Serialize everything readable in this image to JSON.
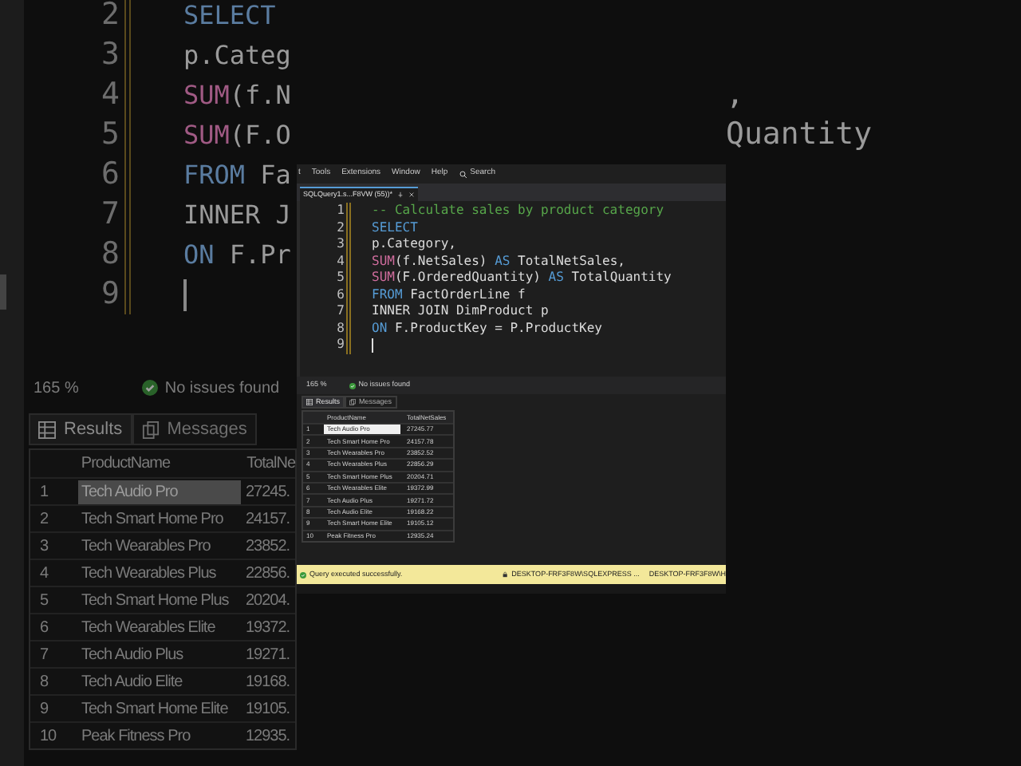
{
  "background_editor": {
    "lines": [
      {
        "number": "2",
        "code": [
          {
            "kind": "keyword",
            "text": "SELECT"
          }
        ]
      },
      {
        "number": "3",
        "code": [
          {
            "kind": "plain",
            "text": "p.Categ"
          }
        ]
      },
      {
        "number": "4",
        "code": [
          {
            "kind": "function",
            "text": "SUM"
          },
          {
            "kind": "plain",
            "text": "(f.N"
          }
        ],
        "overflow": ","
      },
      {
        "number": "5",
        "code": [
          {
            "kind": "function",
            "text": "SUM"
          },
          {
            "kind": "plain",
            "text": "(F.O"
          }
        ],
        "overflow": "Quantity"
      },
      {
        "number": "6",
        "code": [
          {
            "kind": "keyword",
            "text": "FROM"
          },
          {
            "kind": "plain",
            "text": " Fa"
          }
        ]
      },
      {
        "number": "7",
        "code": [
          {
            "kind": "plain",
            "text": "INNER J"
          }
        ]
      },
      {
        "number": "8",
        "code": [
          {
            "kind": "keyword",
            "text": "ON"
          },
          {
            "kind": "plain",
            "text": " F.Pr"
          }
        ]
      },
      {
        "number": "9",
        "cursor": true
      }
    ],
    "status": {
      "zoom": "165 %",
      "issues": "No issues found"
    },
    "tabs": [
      {
        "label": "Results",
        "selected": true
      },
      {
        "label": "Messages",
        "selected": false
      }
    ],
    "grid": {
      "columns": [
        "ProductName",
        "TotalNe"
      ],
      "rows": [
        {
          "index": "1",
          "name": "Tech Audio Pro",
          "value": "27245.",
          "selected": true
        },
        {
          "index": "2",
          "name": "Tech Smart Home Pro",
          "value": "24157.",
          "selected": false
        },
        {
          "index": "3",
          "name": "Tech Wearables Pro",
          "value": "23852.",
          "selected": false
        },
        {
          "index": "4",
          "name": "Tech Wearables Plus",
          "value": "22856.",
          "selected": false
        },
        {
          "index": "5",
          "name": "Tech Smart Home Plus",
          "value": "20204.",
          "selected": false
        },
        {
          "index": "6",
          "name": "Tech Wearables Elite",
          "value": "19372.",
          "selected": false
        },
        {
          "index": "7",
          "name": "Tech Audio Plus",
          "value": "19271.",
          "selected": false
        },
        {
          "index": "8",
          "name": "Tech Audio Elite",
          "value": "19168.",
          "selected": false
        },
        {
          "index": "9",
          "name": "Tech Smart Home Elite",
          "value": "19105.",
          "selected": false
        },
        {
          "index": "10",
          "name": "Peak Fitness Pro",
          "value": "12935.",
          "selected": false
        }
      ]
    }
  },
  "window": {
    "menu": [
      "t",
      "Tools",
      "Extensions",
      "Window",
      "Help"
    ],
    "search": "Search",
    "doc_tab": "SQLQuery1.s...F8VW (55))*",
    "lines": [
      {
        "number": "1",
        "code": [
          {
            "kind": "comment",
            "text": "-- Calculate sales by product category"
          }
        ]
      },
      {
        "number": "2",
        "code": [
          {
            "kind": "keyword",
            "text": "SELECT"
          }
        ]
      },
      {
        "number": "3",
        "code": [
          {
            "kind": "plain",
            "text": "p.Category,"
          }
        ]
      },
      {
        "number": "4",
        "code": [
          {
            "kind": "function",
            "text": "SUM"
          },
          {
            "kind": "plain",
            "text": "(f.NetSales) "
          },
          {
            "kind": "keyword",
            "text": "AS"
          },
          {
            "kind": "plain",
            "text": " TotalNetSales,"
          }
        ]
      },
      {
        "number": "5",
        "code": [
          {
            "kind": "function",
            "text": "SUM"
          },
          {
            "kind": "plain",
            "text": "(F.OrderedQuantity) "
          },
          {
            "kind": "keyword",
            "text": "AS"
          },
          {
            "kind": "plain",
            "text": " TotalQuantity"
          }
        ]
      },
      {
        "number": "6",
        "code": [
          {
            "kind": "keyword",
            "text": "FROM"
          },
          {
            "kind": "plain",
            "text": " FactOrderLine f"
          }
        ]
      },
      {
        "number": "7",
        "code": [
          {
            "kind": "plain",
            "text": "INNER JOIN DimProduct p"
          }
        ]
      },
      {
        "number": "8",
        "code": [
          {
            "kind": "keyword",
            "text": "ON"
          },
          {
            "kind": "plain",
            "text": " F.ProductKey = P.ProductKey"
          }
        ]
      },
      {
        "number": "9",
        "cursor": true
      }
    ],
    "status": {
      "zoom": "165 %",
      "issues": "No issues found"
    },
    "tabs": [
      {
        "label": "Results",
        "selected": true
      },
      {
        "label": "Messages",
        "selected": false
      }
    ],
    "grid": {
      "columns": [
        "ProductName",
        "TotalNetSales"
      ],
      "rows": [
        {
          "index": "1",
          "name": "Tech Audio Pro",
          "value": "27245.77",
          "selected": true
        },
        {
          "index": "2",
          "name": "Tech Smart Home Pro",
          "value": "24157.78",
          "selected": false
        },
        {
          "index": "3",
          "name": "Tech Wearables Pro",
          "value": "23852.52",
          "selected": false
        },
        {
          "index": "4",
          "name": "Tech Wearables Plus",
          "value": "22856.29",
          "selected": false
        },
        {
          "index": "5",
          "name": "Tech Smart Home Plus",
          "value": "20204.71",
          "selected": false
        },
        {
          "index": "6",
          "name": "Tech Wearables Elite",
          "value": "19372.99",
          "selected": false
        },
        {
          "index": "7",
          "name": "Tech Audio Plus",
          "value": "19271.72",
          "selected": false
        },
        {
          "index": "8",
          "name": "Tech Audio Elite",
          "value": "19168.22",
          "selected": false
        },
        {
          "index": "9",
          "name": "Tech Smart Home Elite",
          "value": "19105.12",
          "selected": false
        },
        {
          "index": "10",
          "name": "Peak Fitness Pro",
          "value": "12935.24",
          "selected": false
        }
      ]
    },
    "status_bar": {
      "message": "Query executed successfully.",
      "server": "DESKTOP-FRF3F8W\\SQLEXPRESS ...",
      "user": "DESKTOP-FRF3F8W\\H"
    }
  }
}
